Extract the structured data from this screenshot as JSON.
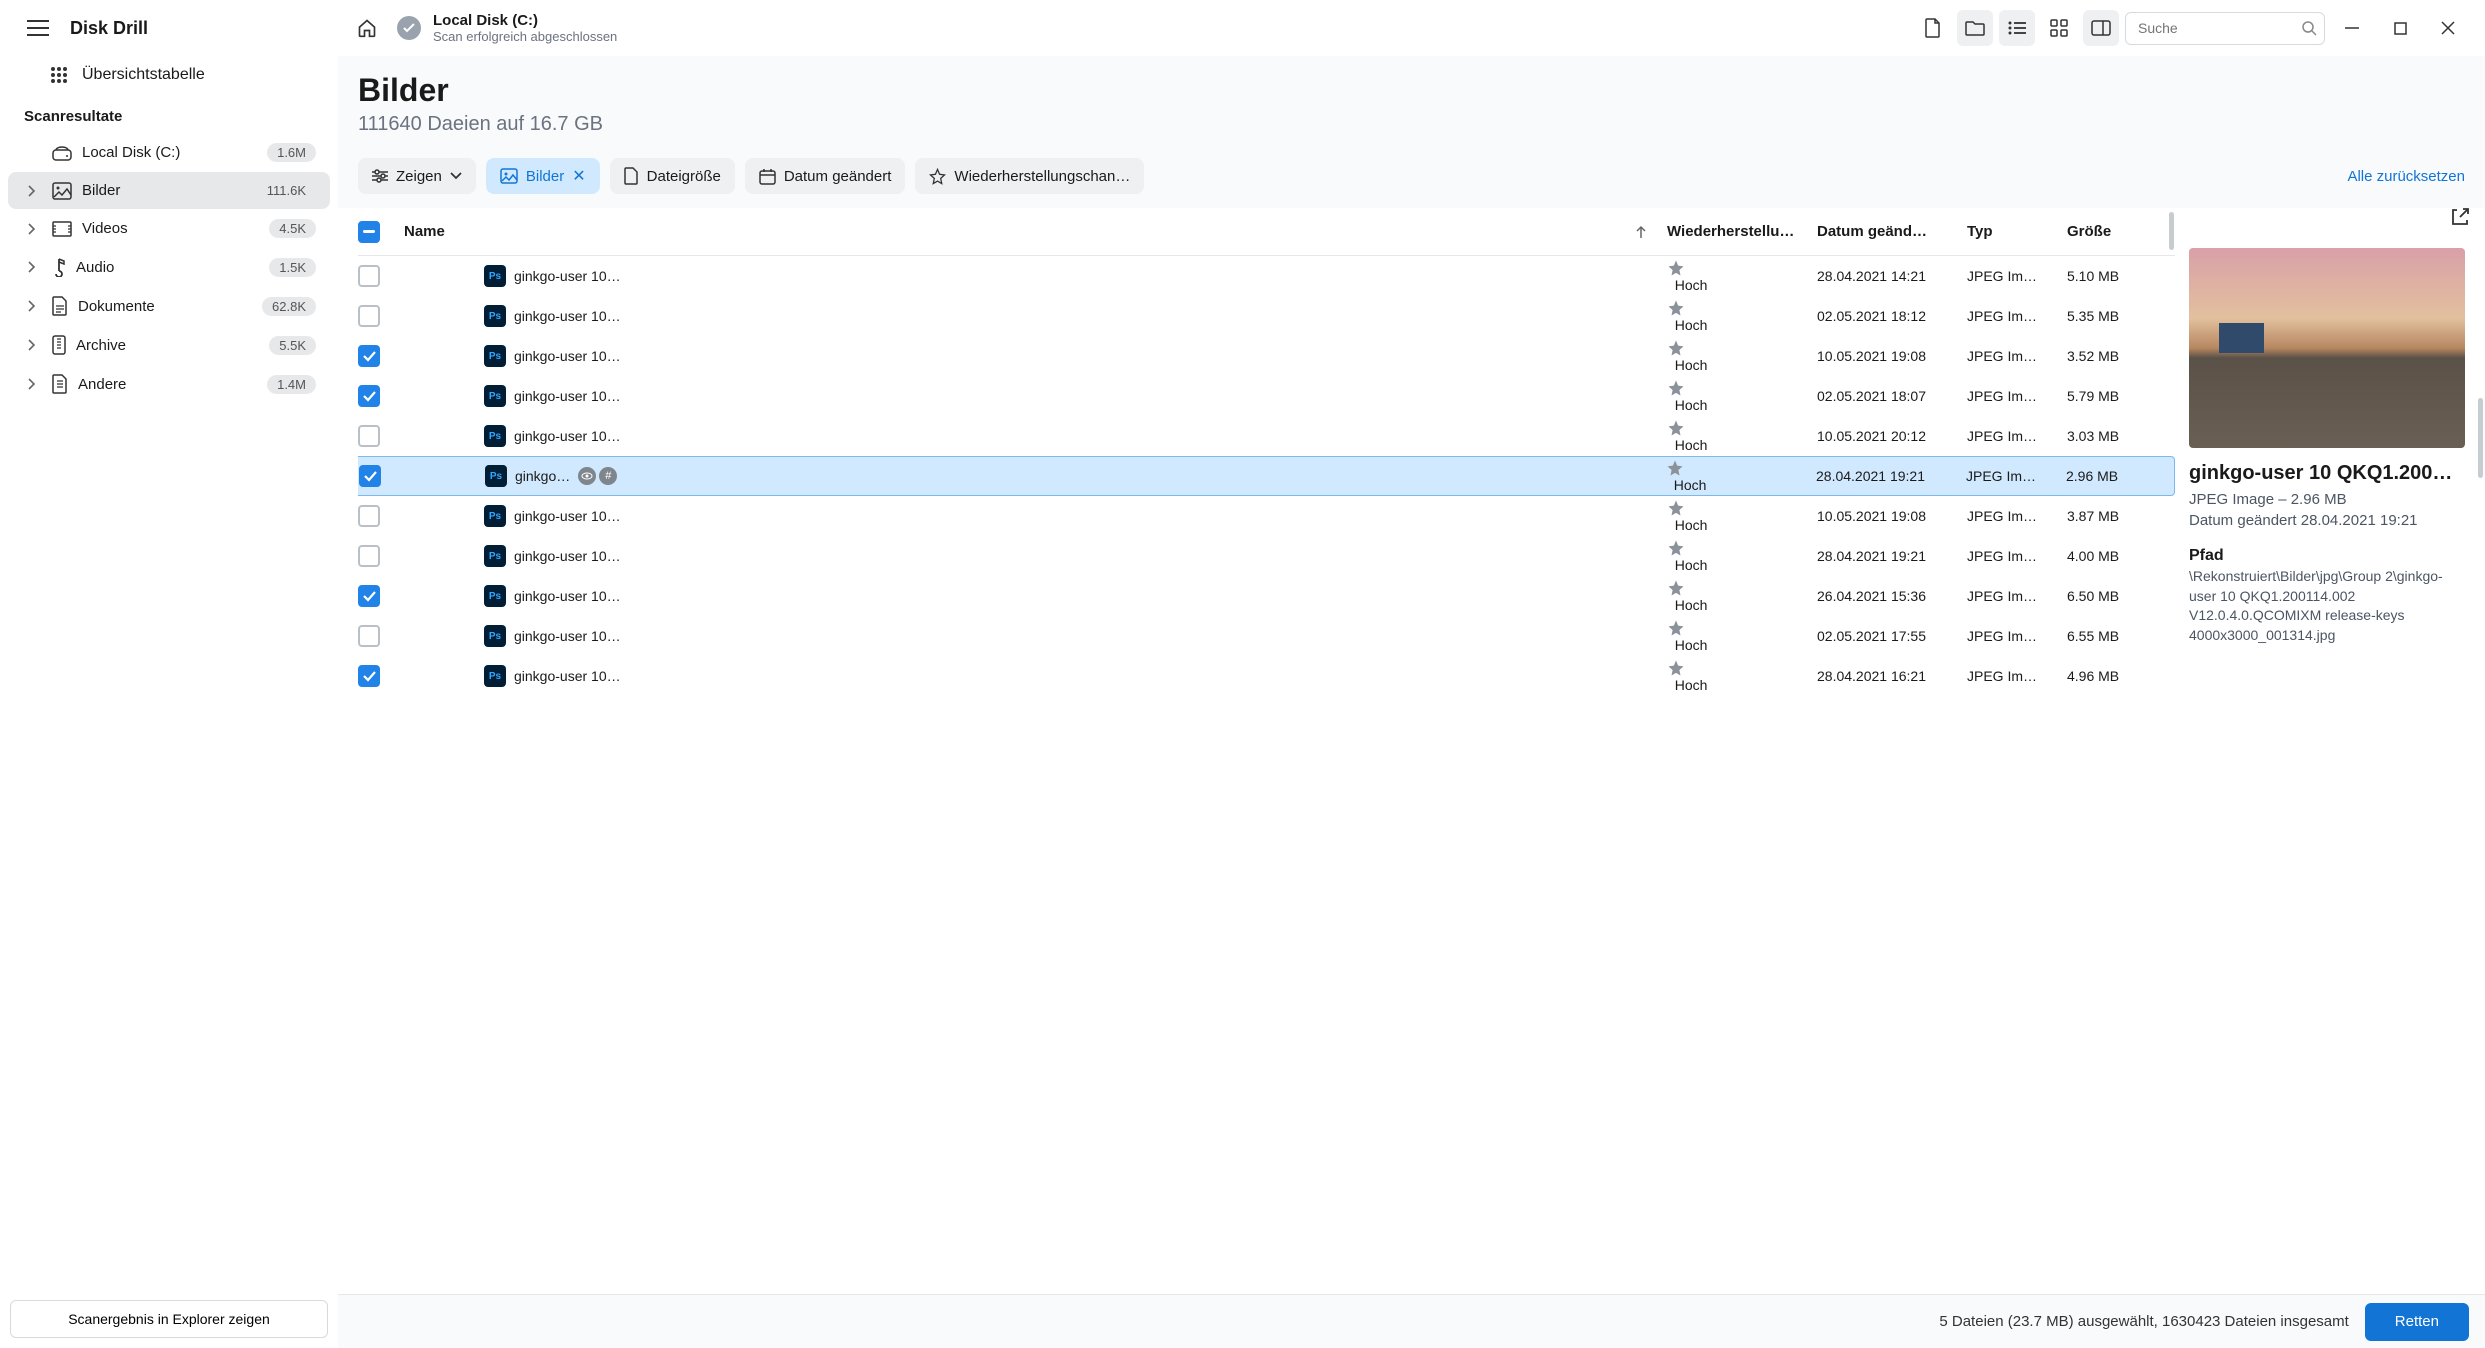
{
  "app_name": "Disk Drill",
  "topbar": {
    "scan_title": "Local Disk (C:)",
    "scan_sub": "Scan erfolgreich abgeschlossen",
    "search_placeholder": "Suche"
  },
  "sidebar": {
    "overview_label": "Übersichtstabelle",
    "section_label": "Scanresultate",
    "items": [
      {
        "label": "Local Disk (C:)",
        "count": "1.6M"
      },
      {
        "label": "Bilder",
        "count": "111.6K"
      },
      {
        "label": "Videos",
        "count": "4.5K"
      },
      {
        "label": "Audio",
        "count": "1.5K"
      },
      {
        "label": "Dokumente",
        "count": "62.8K"
      },
      {
        "label": "Archive",
        "count": "5.5K"
      },
      {
        "label": "Andere",
        "count": "1.4M"
      }
    ],
    "footer_button": "Scanergebnis in Explorer zeigen"
  },
  "header": {
    "title": "Bilder",
    "subtitle": "111640 Daeien auf 16.7 GB"
  },
  "chips": {
    "show": "Zeigen",
    "bilder": "Bilder",
    "size": "Dateigröße",
    "date": "Datum geändert",
    "recovery": "Wiederherstellungschan…",
    "reset": "Alle zurücksetzen"
  },
  "table": {
    "headers": {
      "name": "Name",
      "recovery": "Wiederherstellu…",
      "date": "Datum geänd…",
      "type": "Typ",
      "size": "Größe"
    },
    "rows": [
      {
        "checked": false,
        "name": "ginkgo-user 10…",
        "rec": "Hoch",
        "date": "28.04.2021 14:21",
        "type": "JPEG Im…",
        "size": "5.10 MB",
        "sel": false,
        "badges": false
      },
      {
        "checked": false,
        "name": "ginkgo-user 10…",
        "rec": "Hoch",
        "date": "02.05.2021 18:12",
        "type": "JPEG Im…",
        "size": "5.35 MB",
        "sel": false,
        "badges": false
      },
      {
        "checked": true,
        "name": "ginkgo-user 10…",
        "rec": "Hoch",
        "date": "10.05.2021 19:08",
        "type": "JPEG Im…",
        "size": "3.52 MB",
        "sel": false,
        "badges": false
      },
      {
        "checked": true,
        "name": "ginkgo-user 10…",
        "rec": "Hoch",
        "date": "02.05.2021 18:07",
        "type": "JPEG Im…",
        "size": "5.79 MB",
        "sel": false,
        "badges": false
      },
      {
        "checked": false,
        "name": "ginkgo-user 10…",
        "rec": "Hoch",
        "date": "10.05.2021 20:12",
        "type": "JPEG Im…",
        "size": "3.03 MB",
        "sel": false,
        "badges": false
      },
      {
        "checked": true,
        "name": "ginkgo…",
        "rec": "Hoch",
        "date": "28.04.2021 19:21",
        "type": "JPEG Im…",
        "size": "2.96 MB",
        "sel": true,
        "badges": true
      },
      {
        "checked": false,
        "name": "ginkgo-user 10…",
        "rec": "Hoch",
        "date": "10.05.2021 19:08",
        "type": "JPEG Im…",
        "size": "3.87 MB",
        "sel": false,
        "badges": false
      },
      {
        "checked": false,
        "name": "ginkgo-user 10…",
        "rec": "Hoch",
        "date": "28.04.2021 19:21",
        "type": "JPEG Im…",
        "size": "4.00 MB",
        "sel": false,
        "badges": false
      },
      {
        "checked": true,
        "name": "ginkgo-user 10…",
        "rec": "Hoch",
        "date": "26.04.2021 15:36",
        "type": "JPEG Im…",
        "size": "6.50 MB",
        "sel": false,
        "badges": false
      },
      {
        "checked": false,
        "name": "ginkgo-user 10…",
        "rec": "Hoch",
        "date": "02.05.2021 17:55",
        "type": "JPEG Im…",
        "size": "6.55 MB",
        "sel": false,
        "badges": false
      },
      {
        "checked": true,
        "name": "ginkgo-user 10…",
        "rec": "Hoch",
        "date": "28.04.2021 16:21",
        "type": "JPEG Im…",
        "size": "4.96 MB",
        "sel": false,
        "badges": false
      }
    ]
  },
  "preview": {
    "title": "ginkgo-user 10 QKQ1.200…",
    "meta1": "JPEG Image – 2.96 MB",
    "meta2": "Datum geändert 28.04.2021 19:21",
    "path_label": "Pfad",
    "path_value": "\\Rekonstruiert\\Bilder\\jpg\\Group 2\\ginkgo-user 10 QKQ1.200114.002 V12.0.4.0.QCOMIXM release-keys 4000x3000_001314.jpg"
  },
  "footer": {
    "status": "5 Dateien (23.7 MB) ausgewählt, 1630423 Dateien insgesamt",
    "button": "Retten"
  }
}
